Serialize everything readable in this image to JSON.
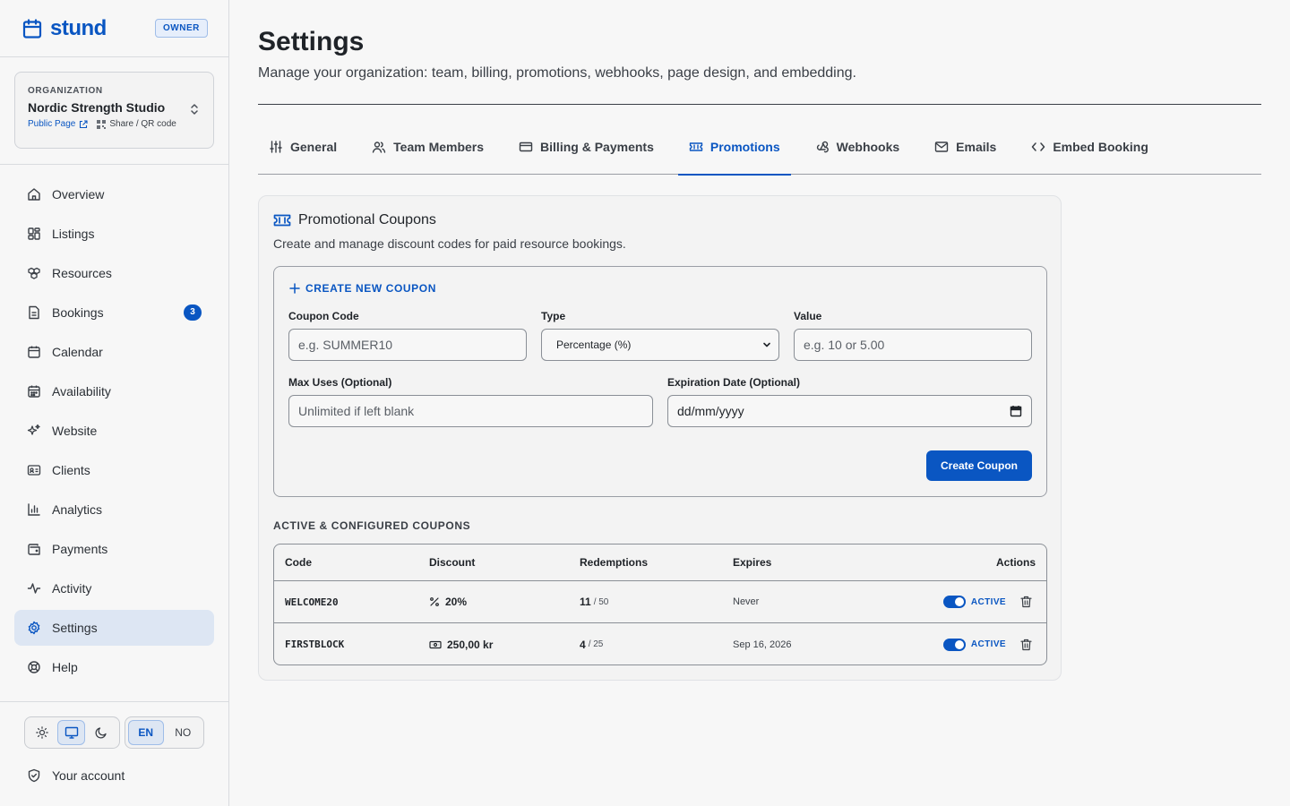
{
  "brand": {
    "name": "stund",
    "role_badge": "OWNER"
  },
  "organization": {
    "label": "ORGANIZATION",
    "name": "Nordic Strength Studio",
    "public_page": "Public Page",
    "share": "Share / QR code"
  },
  "nav": [
    {
      "label": "Overview",
      "icon": "home-icon"
    },
    {
      "label": "Listings",
      "icon": "grid-icon"
    },
    {
      "label": "Resources",
      "icon": "boxes-icon"
    },
    {
      "label": "Bookings",
      "icon": "file-icon",
      "badge": "3"
    },
    {
      "label": "Calendar",
      "icon": "calendar-icon"
    },
    {
      "label": "Availability",
      "icon": "calendar-grid-icon"
    },
    {
      "label": "Website",
      "icon": "sparkles-icon"
    },
    {
      "label": "Clients",
      "icon": "id-card-icon"
    },
    {
      "label": "Analytics",
      "icon": "bar-chart-icon"
    },
    {
      "label": "Payments",
      "icon": "wallet-icon"
    },
    {
      "label": "Activity",
      "icon": "activity-icon"
    },
    {
      "label": "Settings",
      "icon": "gear-icon",
      "active": true
    },
    {
      "label": "Help",
      "icon": "lifebuoy-icon"
    }
  ],
  "theme": {
    "selected": "system"
  },
  "language": {
    "options": [
      "EN",
      "NO"
    ],
    "selected": "EN"
  },
  "account": {
    "label": "Your account"
  },
  "page": {
    "title": "Settings",
    "subtitle": "Manage your organization: team, billing, promotions, webhooks, page design, and embedding."
  },
  "tabs": [
    {
      "label": "General",
      "icon": "sliders-icon"
    },
    {
      "label": "Team Members",
      "icon": "users-icon"
    },
    {
      "label": "Billing & Payments",
      "icon": "credit-card-icon"
    },
    {
      "label": "Promotions",
      "icon": "ticket-icon",
      "active": true
    },
    {
      "label": "Webhooks",
      "icon": "webhook-icon"
    },
    {
      "label": "Emails",
      "icon": "mail-icon"
    },
    {
      "label": "Embed Booking",
      "icon": "code-icon"
    }
  ],
  "coupons": {
    "title": "Promotional Coupons",
    "description": "Create and manage discount codes for paid resource bookings.",
    "form": {
      "title": "CREATE NEW COUPON",
      "code_label": "Coupon Code",
      "code_placeholder": "e.g. SUMMER10",
      "type_label": "Type",
      "type_value": "Percentage (%)",
      "value_label": "Value",
      "value_placeholder": "e.g. 10 or 5.00",
      "max_uses_label": "Max Uses (Optional)",
      "max_uses_placeholder": "Unlimited if left blank",
      "expiration_label": "Expiration Date (Optional)",
      "expiration_placeholder": "dd/mm/yyyy",
      "submit_label": "Create Coupon"
    },
    "list_title": "ACTIVE & CONFIGURED COUPONS",
    "columns": [
      "Code",
      "Discount",
      "Redemptions",
      "Expires",
      "Actions"
    ],
    "rows": [
      {
        "code": "WELCOME20",
        "discount": "20%",
        "discount_icon": "percent-icon",
        "used": "11",
        "limit": "/ 50",
        "expires": "Never",
        "status": "ACTIVE"
      },
      {
        "code": "FIRSTBLOCK",
        "discount": "250,00 kr",
        "discount_icon": "banknote-icon",
        "used": "4",
        "limit": "/ 25",
        "expires": "Sep 16, 2026",
        "status": "ACTIVE"
      }
    ]
  },
  "colors": {
    "accent": "#0a56c2",
    "background": "#f7f7f7",
    "active_nav": "#dde6f3"
  }
}
